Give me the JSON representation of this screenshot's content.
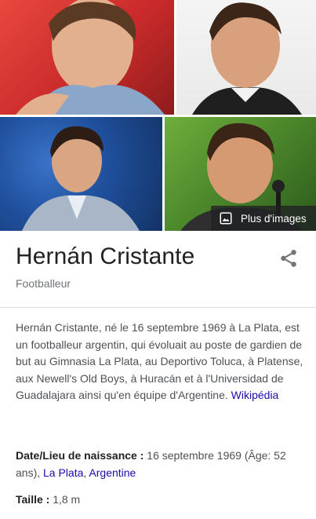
{
  "images": {
    "more_label": "Plus d'images",
    "tiles": [
      {
        "alt": "photo-1",
        "color": "#d63b34"
      },
      {
        "alt": "photo-2",
        "color": "#ececec"
      },
      {
        "alt": "photo-3",
        "color": "#2a5fb0"
      },
      {
        "alt": "photo-4",
        "color": "#5c9a32"
      }
    ]
  },
  "entity": {
    "title": "Hernán Cristante",
    "subtitle": "Footballeur",
    "description": "Hernán Cristante, né le 16 septembre 1969 à La Plata, est un footballeur argentin, qui évoluait au poste de gardien de but au Gimnasia La Plata, au Deportivo Toluca, à Platense, aux Newell's Old Boys, à Huracán et à l'Universidad de Guadalajara ainsi qu'en équipe d'Argentine.",
    "source_link": "Wikipédia"
  },
  "facts": {
    "birth": {
      "label": "Date/Lieu de naissance :",
      "value": "16 septembre 1969 (Âge: 52 ans),",
      "link1": "La Plata",
      "sep": ",",
      "link2": "Argentine"
    },
    "height": {
      "label": "Taille :",
      "value": "1,8 m"
    }
  },
  "colors": {
    "link": "#1a0dab",
    "text": "#202124",
    "secondary": "#70757a"
  }
}
